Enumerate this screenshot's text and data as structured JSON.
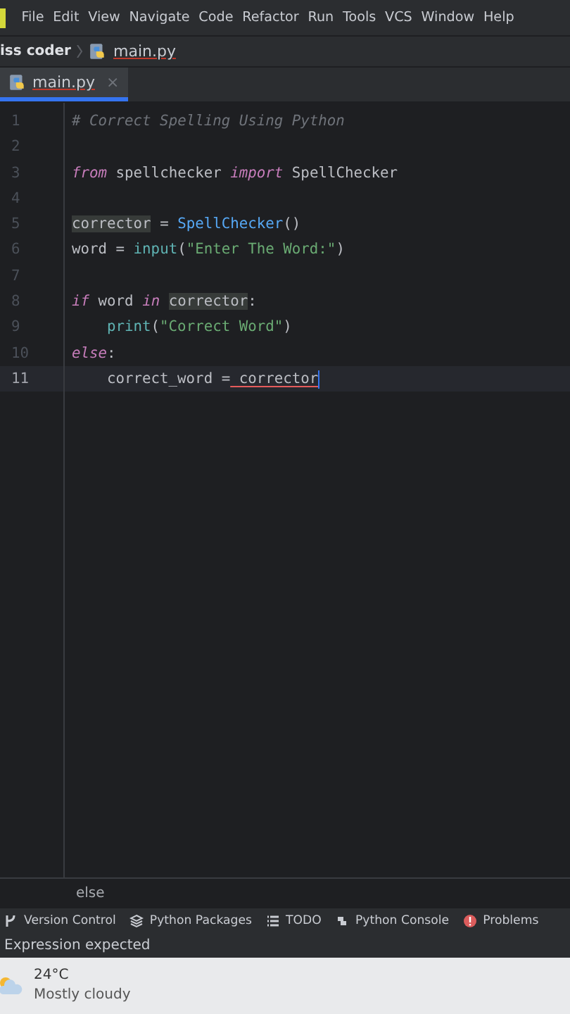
{
  "menu": [
    "File",
    "Edit",
    "View",
    "Navigate",
    "Code",
    "Refactor",
    "Run",
    "Tools",
    "VCS",
    "Window",
    "Help"
  ],
  "breadcrumb": {
    "project": "iss coder",
    "file": "main.py"
  },
  "tabs": [
    {
      "label": "main.py",
      "selected": true,
      "close": "×"
    }
  ],
  "editor": {
    "lines": [
      {
        "number": "1",
        "tokens": [
          {
            "kind": "comment",
            "text": "# Correct Spelling Using Python"
          }
        ]
      },
      {
        "number": "2"
      },
      {
        "number": "3",
        "tokens": [
          {
            "kind": "keyword",
            "text": "from"
          },
          {
            "kind": "plain",
            "text": " spellchecker "
          },
          {
            "kind": "keyword",
            "text": "import"
          },
          {
            "kind": "plain",
            "text": " SpellChecker"
          }
        ]
      },
      {
        "number": "4"
      },
      {
        "number": "5",
        "tokens": [
          {
            "kind": "plain",
            "text": "corrector",
            "highlight": true
          },
          {
            "kind": "plain",
            "text": " = "
          },
          {
            "kind": "call",
            "text": "SpellChecker"
          },
          {
            "kind": "plain",
            "text": "()"
          }
        ]
      },
      {
        "number": "6",
        "tokens": [
          {
            "kind": "plain",
            "text": "word = "
          },
          {
            "kind": "builtin",
            "text": "input"
          },
          {
            "kind": "plain",
            "text": "("
          },
          {
            "kind": "string",
            "text": "\"Enter The Word:\""
          },
          {
            "kind": "plain",
            "text": ")"
          }
        ]
      },
      {
        "number": "7"
      },
      {
        "number": "8",
        "tokens": [
          {
            "kind": "keyword",
            "text": "if"
          },
          {
            "kind": "plain",
            "text": " word "
          },
          {
            "kind": "keyword",
            "text": "in "
          },
          {
            "kind": "plain",
            "text": "corrector",
            "highlight": true
          },
          {
            "kind": "plain",
            "text": ":"
          }
        ]
      },
      {
        "number": "9",
        "indent": true,
        "tokens": [
          {
            "kind": "builtin",
            "text": "print"
          },
          {
            "kind": "plain",
            "text": "("
          },
          {
            "kind": "string",
            "text": "\"Correct Word\""
          },
          {
            "kind": "plain",
            "text": ")"
          }
        ]
      },
      {
        "number": "10",
        "tokens": [
          {
            "kind": "keyword",
            "text": "else"
          },
          {
            "kind": "plain",
            "text": ":"
          }
        ]
      },
      {
        "number": "11",
        "current": true,
        "indent": true,
        "tokens": [
          {
            "kind": "plain",
            "text": "correct_word ="
          },
          {
            "kind": "plain",
            "text": " corrector",
            "error": true
          }
        ]
      }
    ]
  },
  "footer_breadcrumb": "else",
  "tool_windows": [
    {
      "kind": "vcs",
      "label": "Version Control"
    },
    {
      "kind": "packages",
      "label": "Python Packages"
    },
    {
      "kind": "todo",
      "label": "TODO"
    },
    {
      "kind": "console",
      "label": "Python Console"
    },
    {
      "kind": "problems",
      "label": "Problems"
    }
  ],
  "status": "Expression expected",
  "weather": {
    "temperature": "24°C",
    "condition": "Mostly cloudy"
  }
}
